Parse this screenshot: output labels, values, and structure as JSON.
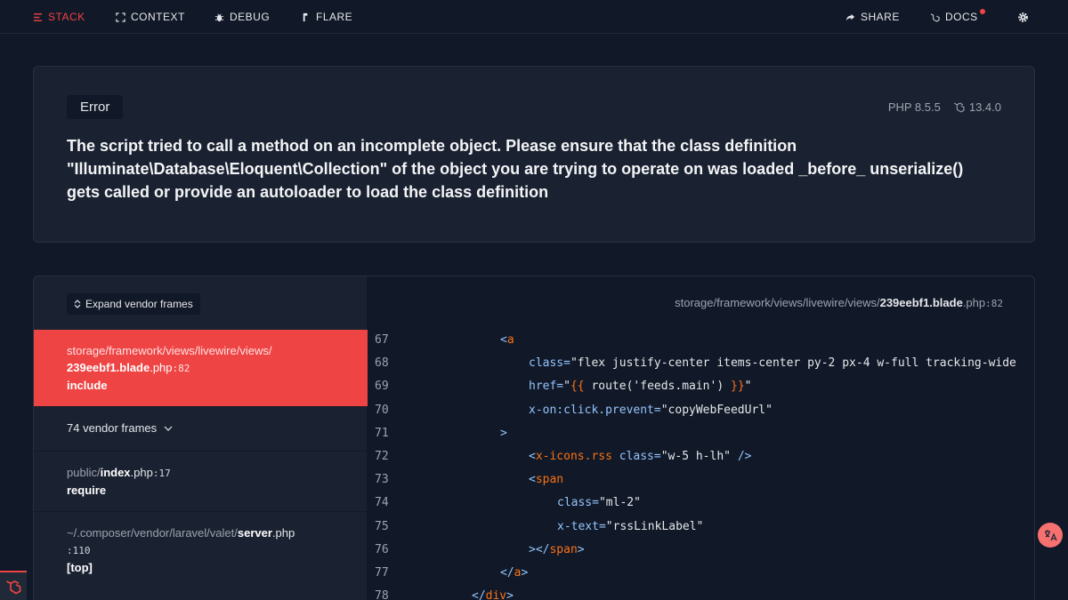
{
  "nav": {
    "stack": "STACK",
    "context": "CONTEXT",
    "debug": "DEBUG",
    "flare": "FLARE",
    "share": "SHARE",
    "docs": "DOCS"
  },
  "error": {
    "badge": "Error",
    "php_version": "PHP 8.5.5",
    "laravel_version": "13.4.0",
    "message": "The script tried to call a method on an incomplete object. Please ensure that the class definition \"Illuminate\\Database\\Eloquent\\Collection\" of the object you are trying to operate on was loaded _before_ unserialize() gets called or provide an autoloader to load the class definition"
  },
  "stack": {
    "expand_label": "Expand vendor frames",
    "frames": [
      {
        "dir": "storage/framework/views/livewire/views/",
        "file": "239eebf1.blade",
        "ext": ".php",
        "line": ":82",
        "fn": "include"
      },
      {
        "vendor": "74 vendor frames"
      },
      {
        "dir": "public/",
        "file": "index",
        "ext": ".php",
        "line": ":17",
        "fn": "require"
      },
      {
        "dir": "~/.composer/vendor/laravel/valet/",
        "file": "server",
        "ext": ".php",
        "line": ":110",
        "fn": "[top]"
      }
    ]
  },
  "code": {
    "file_dir": "storage/framework/views/livewire/views/",
    "file_name": "239eebf1.blade",
    "file_ext": ".php",
    "file_line": ":82",
    "line_numbers": [
      "67",
      "68",
      "69",
      "70",
      "71",
      "72",
      "73",
      "74",
      "75",
      "76",
      "77",
      "78"
    ]
  },
  "colors": {
    "accent": "#ef4444",
    "background": "#111827",
    "card": "#1a2231"
  }
}
